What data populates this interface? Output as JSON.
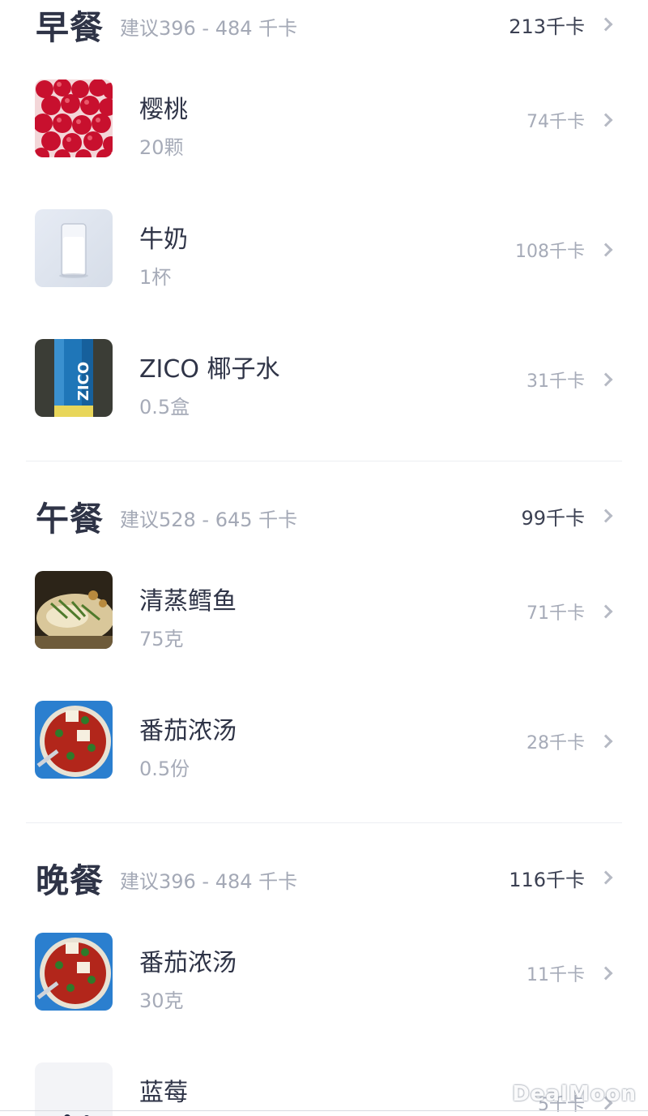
{
  "meals": [
    {
      "title": "早餐",
      "suggest": "建议396 - 484 千卡",
      "total": "213千卡",
      "items": [
        {
          "name": "樱桃",
          "qty": "20颗",
          "kcal": "74千卡",
          "image": "cherries"
        },
        {
          "name": "牛奶",
          "qty": "1杯",
          "kcal": "108千卡",
          "image": "milk-glass"
        },
        {
          "name": "ZICO 椰子水",
          "qty": "0.5盒",
          "kcal": "31千卡",
          "image": "coconut-water-carton"
        }
      ]
    },
    {
      "title": "午餐",
      "suggest": "建议528 - 645 千卡",
      "total": "99千卡",
      "items": [
        {
          "name": "清蒸鳕鱼",
          "qty": "75克",
          "kcal": "71千卡",
          "image": "steamed-cod"
        },
        {
          "name": "番茄浓汤",
          "qty": "0.5份",
          "kcal": "28千卡",
          "image": "tomato-soup"
        }
      ]
    },
    {
      "title": "晚餐",
      "suggest": "建议396 - 484 千卡",
      "total": "116千卡",
      "items": [
        {
          "name": "番茄浓汤",
          "qty": "30克",
          "kcal": "11千卡",
          "image": "tomato-soup"
        },
        {
          "name": "蓝莓",
          "qty": "",
          "kcal": "5千卡",
          "image": "blueberries"
        }
      ]
    }
  ],
  "watermark": "DealMoon",
  "colors": {
    "title": "#2f3447",
    "muted": "#a6abb8",
    "divider": "#eceef2"
  }
}
